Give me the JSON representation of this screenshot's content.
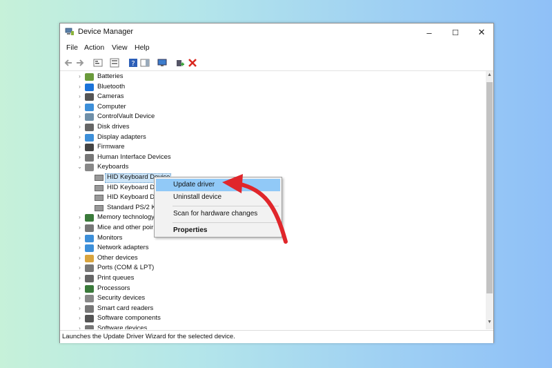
{
  "window": {
    "title": "Device Manager",
    "minimize": "–",
    "maximize": "☐",
    "close": "✕"
  },
  "menu": [
    "File",
    "Action",
    "View",
    "Help"
  ],
  "toolbar": [
    "back-arrow-icon",
    "forward-arrow-icon",
    "properties-icon",
    "show-hidden-icon",
    "help-icon",
    "action-pane-icon",
    "monitor-icon",
    "update-driver-icon",
    "uninstall-icon"
  ],
  "tree": {
    "categories": [
      {
        "label": "Batteries",
        "icon": "battery-icon",
        "expanded": false
      },
      {
        "label": "Bluetooth",
        "icon": "bluetooth-icon",
        "expanded": false
      },
      {
        "label": "Cameras",
        "icon": "camera-icon",
        "expanded": false
      },
      {
        "label": "Computer",
        "icon": "computer-icon",
        "expanded": false
      },
      {
        "label": "ControlVault Device",
        "icon": "controlvault-icon",
        "expanded": false
      },
      {
        "label": "Disk drives",
        "icon": "disk-drive-icon",
        "expanded": false
      },
      {
        "label": "Display adapters",
        "icon": "display-adapter-icon",
        "expanded": false
      },
      {
        "label": "Firmware",
        "icon": "firmware-icon",
        "expanded": false
      },
      {
        "label": "Human Interface Devices",
        "icon": "hid-icon",
        "expanded": false
      },
      {
        "label": "Keyboards",
        "icon": "keyboard-icon",
        "expanded": true
      }
    ],
    "keyboard_children": [
      "HID Keyboard Device",
      "HID Keyboard De",
      "HID Keyboard De",
      "Standard PS/2 Ke"
    ],
    "categories_after": [
      {
        "label": "Memory technology",
        "icon": "memory-icon"
      },
      {
        "label": "Mice and other poir",
        "icon": "mouse-icon"
      },
      {
        "label": "Monitors",
        "icon": "monitor-icon"
      },
      {
        "label": "Network adapters",
        "icon": "network-icon"
      },
      {
        "label": "Other devices",
        "icon": "other-devices-icon"
      },
      {
        "label": "Ports (COM & LPT)",
        "icon": "port-icon"
      },
      {
        "label": "Print queues",
        "icon": "printer-icon"
      },
      {
        "label": "Processors",
        "icon": "processor-icon"
      },
      {
        "label": "Security devices",
        "icon": "security-icon"
      },
      {
        "label": "Smart card readers",
        "icon": "smartcard-icon"
      },
      {
        "label": "Software components",
        "icon": "software-components-icon"
      },
      {
        "label": "Software devices",
        "icon": "software-devices-icon"
      }
    ]
  },
  "context_menu": {
    "items": [
      "Update driver",
      "Uninstall device",
      "Scan for hardware changes",
      "Properties"
    ]
  },
  "status": "Launches the Update Driver Wizard for the selected device.",
  "colors": {
    "highlight": "#91c9f7",
    "arrow": "#e0262b"
  }
}
